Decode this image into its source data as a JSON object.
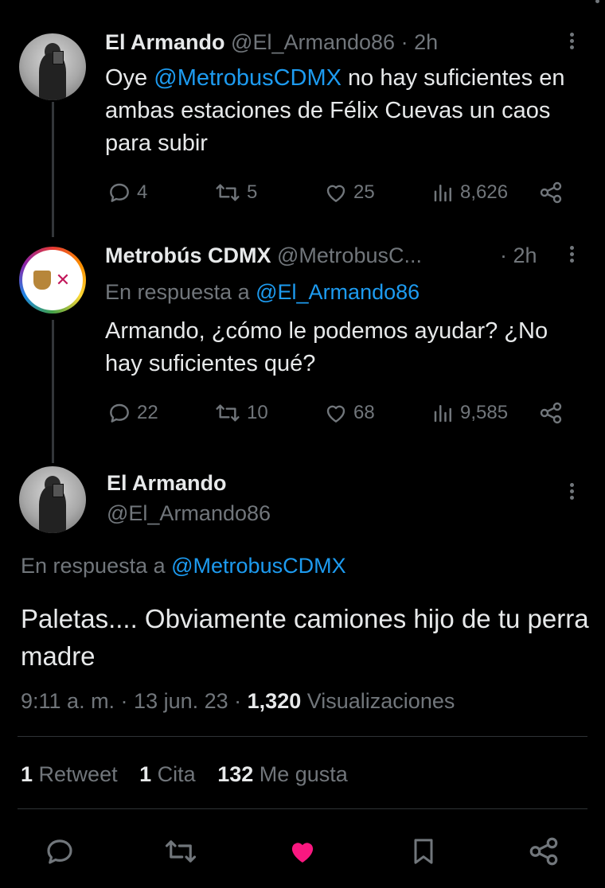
{
  "tweet1": {
    "name": "El Armando",
    "handle": "@El_Armando86",
    "time": "· 2h",
    "text_prefix": "Oye ",
    "mention": "@MetrobusCDMX",
    "text_suffix": " no hay suficientes en ambas estaciones de Félix Cuevas un caos para subir",
    "replies": "4",
    "retweets": "5",
    "likes": "25",
    "views": "8,626"
  },
  "tweet2": {
    "name": "Metrobús CDMX",
    "handle": "@MetrobusC...",
    "time": "· 2h",
    "reply_to_label": "En respuesta a ",
    "reply_to_handle": "@El_Armando86",
    "text": "Armando, ¿cómo le podemos ayudar? ¿No hay suficientes qué?",
    "replies": "22",
    "retweets": "10",
    "likes": "68",
    "views": "9,585"
  },
  "main_tweet": {
    "name": "El Armando",
    "handle": "@El_Armando86",
    "reply_to_label": "En respuesta a ",
    "reply_to_handle": "@MetrobusCDMX",
    "text": "Paletas.... Obviamente camiones hijo de tu perra madre",
    "time": "9:11 a. m. · 13 jun. 23 · ",
    "views_count": "1,320",
    "views_label": " Visualizaciones",
    "stats": {
      "retweets_count": "1",
      "retweets_label": " Retweet",
      "quotes_count": "1",
      "quotes_label": " Cita",
      "likes_count": "132",
      "likes_label": " Me gusta"
    }
  },
  "colors": {
    "background": "#000000",
    "text": "#e7e9ea",
    "muted": "#71767b",
    "link": "#1d9bf0",
    "like_active": "#f91880"
  },
  "icons": [
    "reply-icon",
    "retweet-icon",
    "like-icon",
    "views-icon",
    "share-icon",
    "bookmark-icon",
    "more-icon"
  ]
}
